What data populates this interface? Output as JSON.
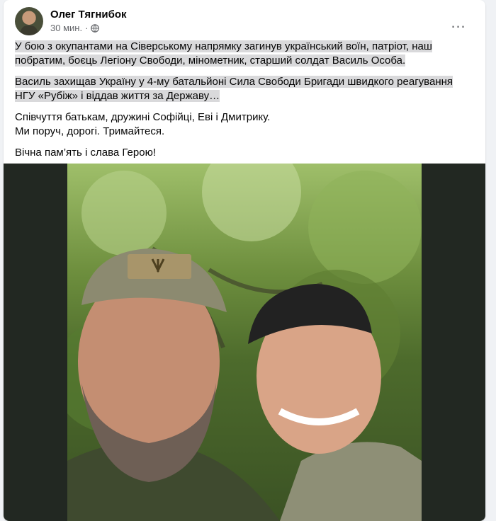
{
  "post": {
    "author": "Олег Тягнибок",
    "time": "30 мин.",
    "separator": "·",
    "more_icon": "…",
    "paragraphs": [
      "У бою з окупантами на Сіверському напрямку загинув український воїн, патріот, наш побратим, боєць Легіону Свободи, мінометник, старший солдат Василь Особа.",
      "Василь захищав Україну у 4-му батальйоні Сила Свободи Бригади швидкого реагування НГУ «Рубіж» і віддав життя за Державу…",
      "Співчуття батькам, дружині Софійці, Еві і Дмитрику.",
      "Ми поруч, дорогі. Тримайтеся.",
      "Вічна пам’ять і слава Герою!"
    ]
  }
}
